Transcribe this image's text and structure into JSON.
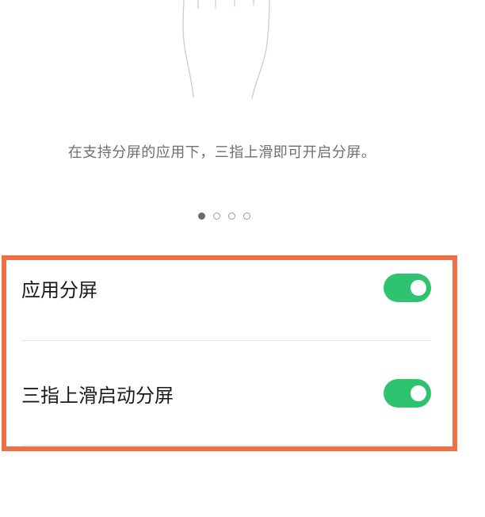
{
  "illustration": {
    "icon": "three-finger-swipe-hand-icon"
  },
  "caption": "在支持分屏的应用下，三指上滑即可开启分屏。",
  "pager": {
    "count": 4,
    "active_index": 0
  },
  "settings": [
    {
      "label": "应用分屏",
      "enabled": true
    },
    {
      "label": "三指上滑启动分屏",
      "enabled": true
    }
  ],
  "colors": {
    "toggle_on": "#2ec36f",
    "highlight_border": "#ef7046",
    "caption_text": "#6f6f6f"
  }
}
